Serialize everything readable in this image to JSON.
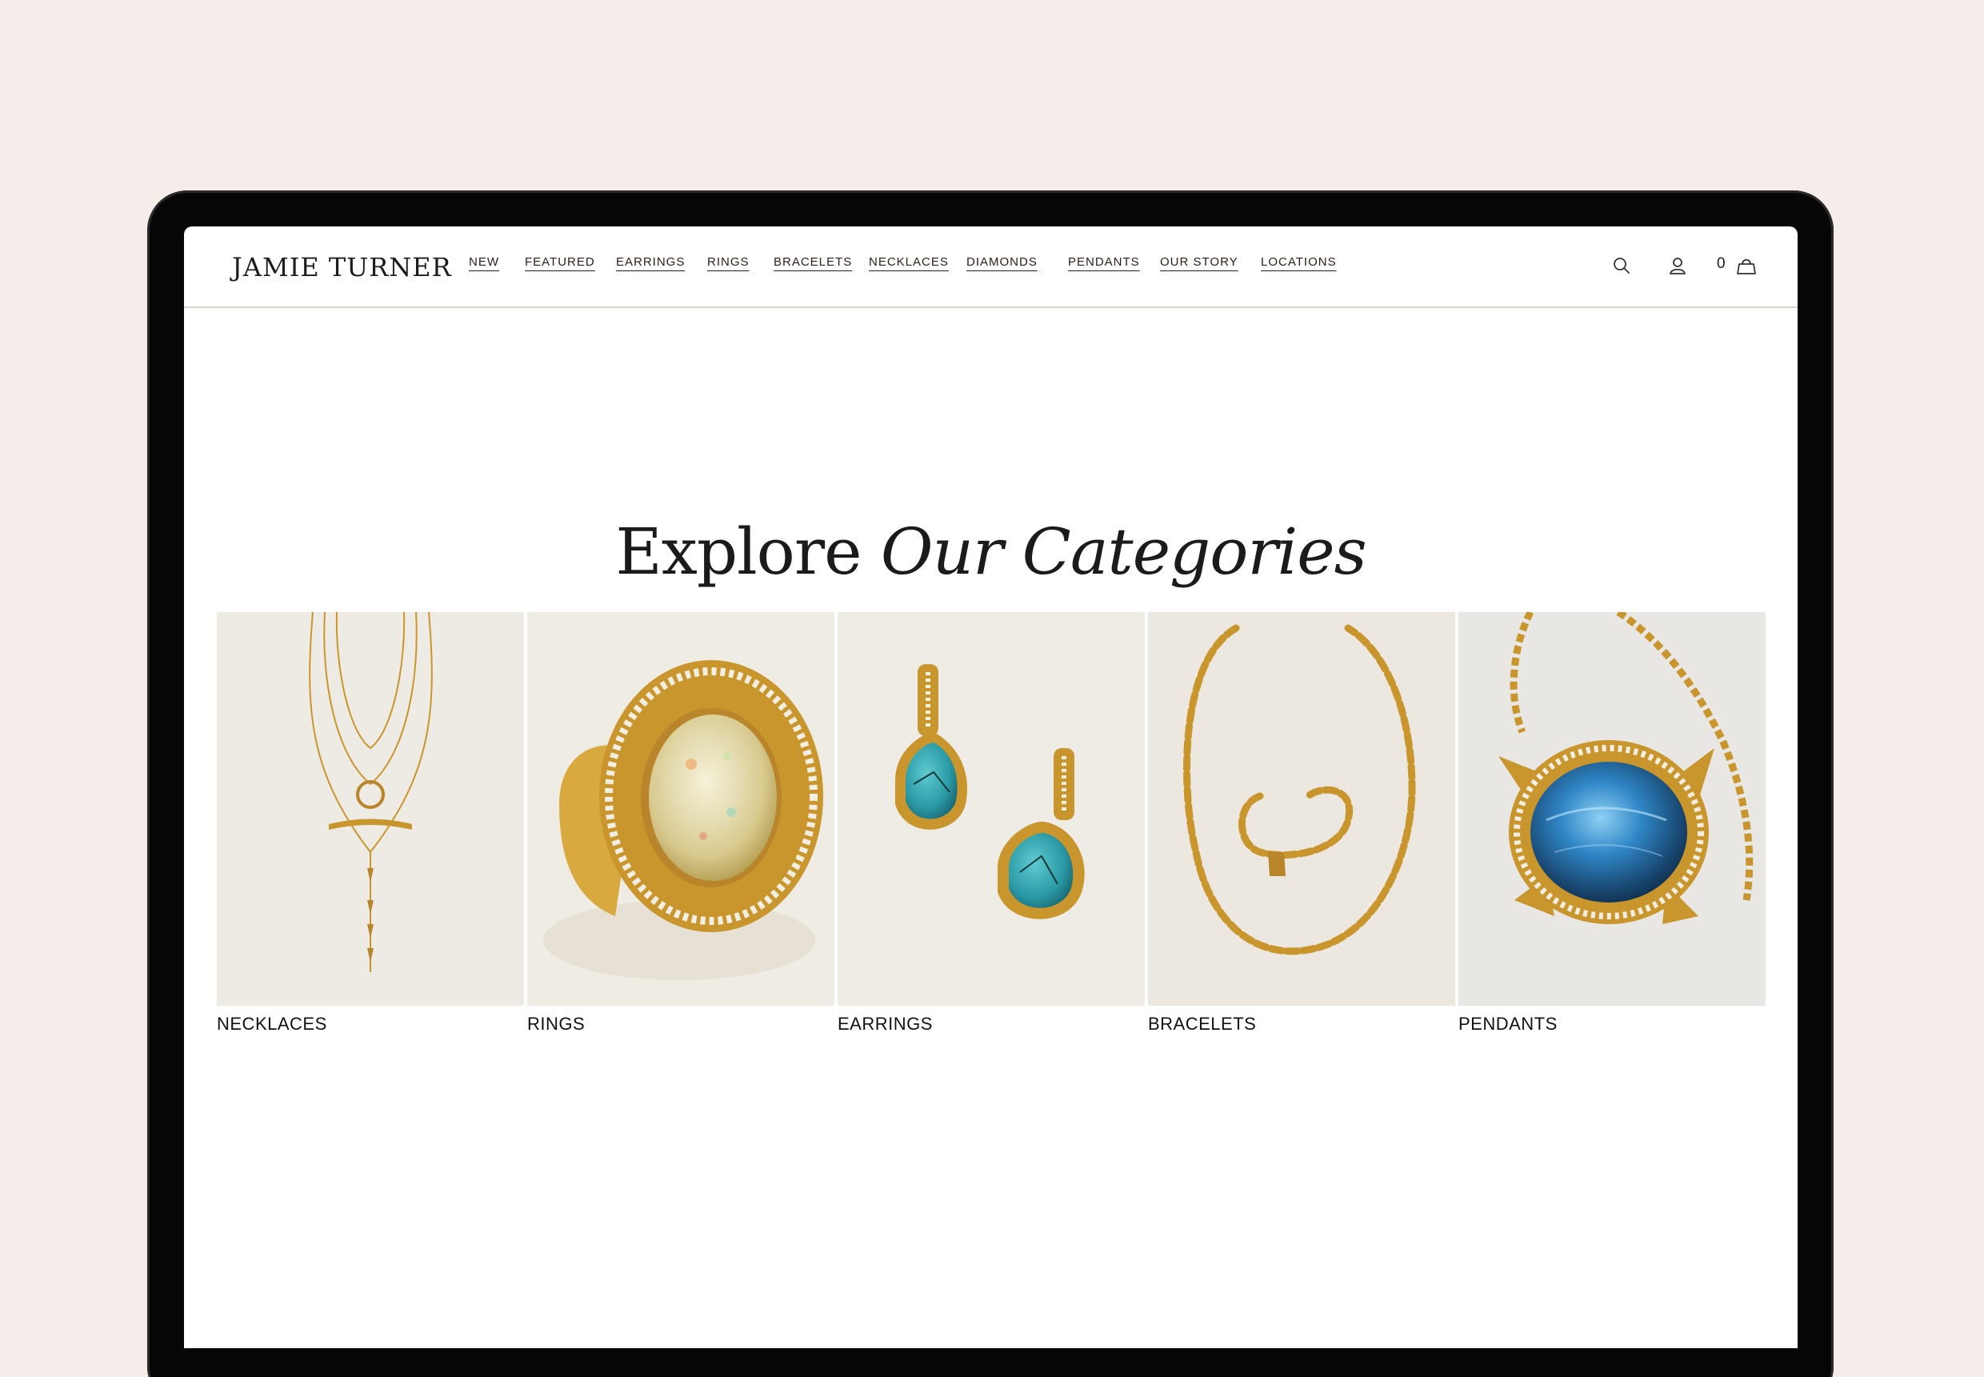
{
  "brand": {
    "name": "JAMIE TURNER"
  },
  "nav": {
    "items": [
      "NEW",
      "FEATURED",
      "EARRINGS",
      "RINGS",
      "BRACELETS",
      "NECKLACES",
      "DIAMONDS",
      "PENDANTS",
      "OUR STORY",
      "LOCATIONS"
    ]
  },
  "header_icons": {
    "search": "search-icon",
    "account": "user-icon",
    "cart": "bag-icon",
    "cart_count": "0"
  },
  "section": {
    "title_plain": "Explore",
    "title_italic": "Our Categories"
  },
  "categories": [
    {
      "label": "NECKLACES",
      "image": "layered gold necklaces"
    },
    {
      "label": "RINGS",
      "image": "gold opal ring with diamonds"
    },
    {
      "label": "EARRINGS",
      "image": "turquoise drop earrings"
    },
    {
      "label": "BRACELETS",
      "image": "gold chain link bracelet and necklace"
    },
    {
      "label": "PENDANTS",
      "image": "labradorite gold pendant"
    }
  ],
  "colors": {
    "page_background": "#f4ede9",
    "device_frame": "#060606",
    "text": "#1b1b1b",
    "gold": "#c9962e"
  }
}
